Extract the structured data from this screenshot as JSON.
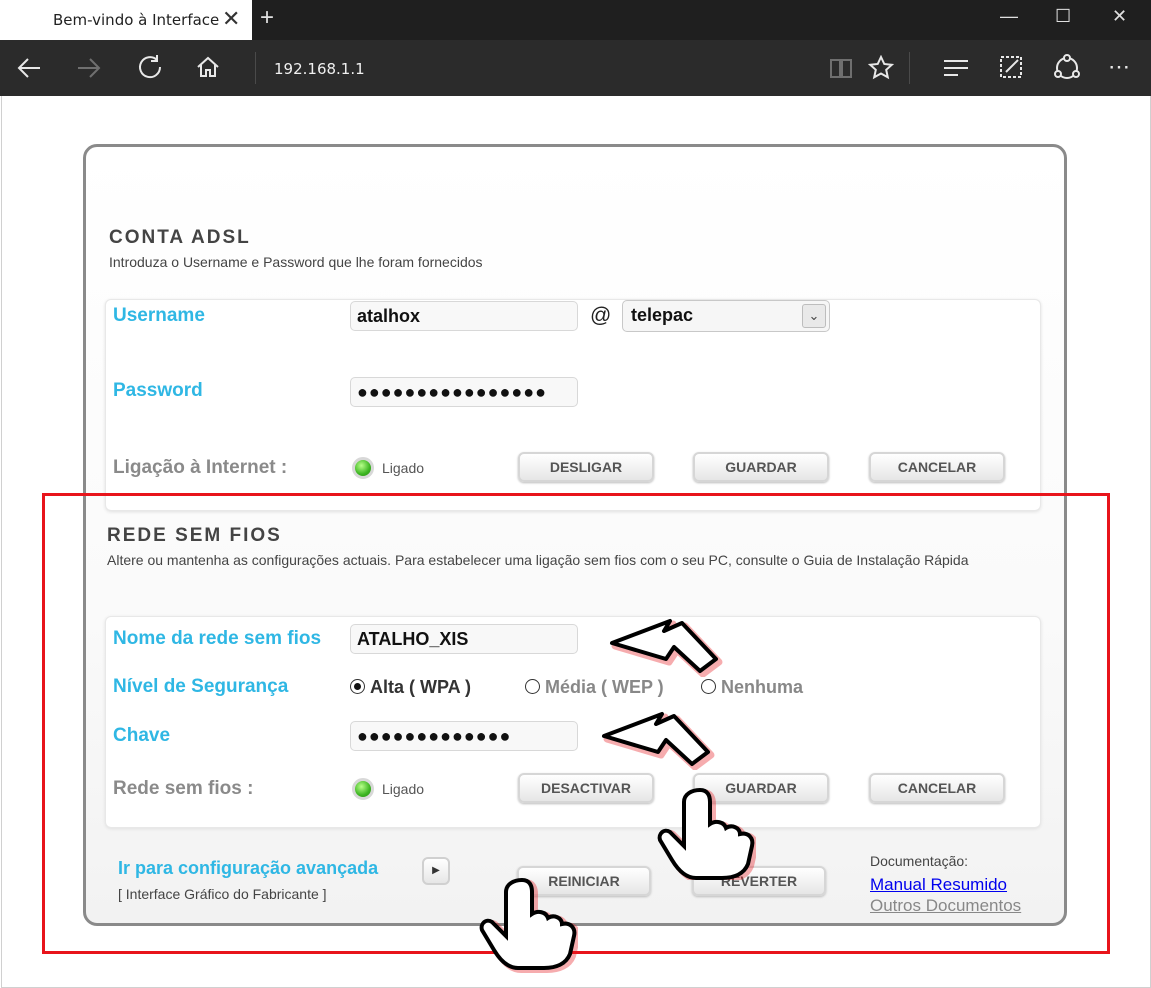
{
  "browser": {
    "tab_title": "Bem-vindo à Interface",
    "tab_close": "✕",
    "new_tab": "+",
    "address": "192.168.1.1",
    "window": {
      "minimize": "—",
      "maximize": "☐",
      "close": "✕"
    },
    "nav_icons": [
      "back-icon",
      "forward-icon",
      "refresh-icon",
      "home-icon",
      "reading-view-icon",
      "favorite-star-icon",
      "hub-icon",
      "web-note-icon",
      "share-icon",
      "more-icon"
    ]
  },
  "adsl": {
    "title": "CONTA ADSL",
    "description": "Introduza o Username e Password que lhe foram fornecidos",
    "username_label": "Username",
    "username_value": "atalhox",
    "at_sign": "@",
    "domain_value": "telepac",
    "password_label": "Password",
    "password_value": "●●●●●●●●●●●●●●●●",
    "connection_label": "Ligação à Internet :",
    "connection_status": "Ligado",
    "btn_disconnect": "DESLIGAR",
    "btn_save": "GUARDAR",
    "btn_cancel": "CANCELAR"
  },
  "wireless": {
    "title": "REDE SEM FIOS",
    "description": "Altere ou mantenha as configurações actuais. Para estabelecer uma ligação sem fios com o seu PC, consulte o Guia de Instalação Rápida",
    "network_name_label": "Nome da rede sem fios",
    "network_name_value": "ATALHO_XIS",
    "security_label": "Nível de Segurança",
    "security_options": [
      "Alta ( WPA )",
      "Média ( WEP )",
      "Nenhuma"
    ],
    "security_selected": "Alta ( WPA )",
    "key_label": "Chave",
    "key_value": "●●●●●●●●●●●●●",
    "status_label": "Rede sem fios :",
    "status_value": "Ligado",
    "btn_deactivate": "DESACTIVAR",
    "btn_save": "GUARDAR",
    "btn_cancel": "CANCELAR"
  },
  "footer": {
    "advanced_link": "Ir para configuração avançada",
    "advanced_sub": "[ Interface Gráfico do Fabricante ]",
    "btn_restart": "REINICIAR",
    "btn_revert": "REVERTER",
    "doc_title": "Documentação:",
    "doc_manual": "Manual Resumido",
    "doc_others": "Outros Documentos"
  },
  "colors": {
    "accent": "#2fb7e4",
    "highlight_box": "#e8141b",
    "browser_chrome": "#2b2b2b",
    "link": "#0000ee"
  }
}
